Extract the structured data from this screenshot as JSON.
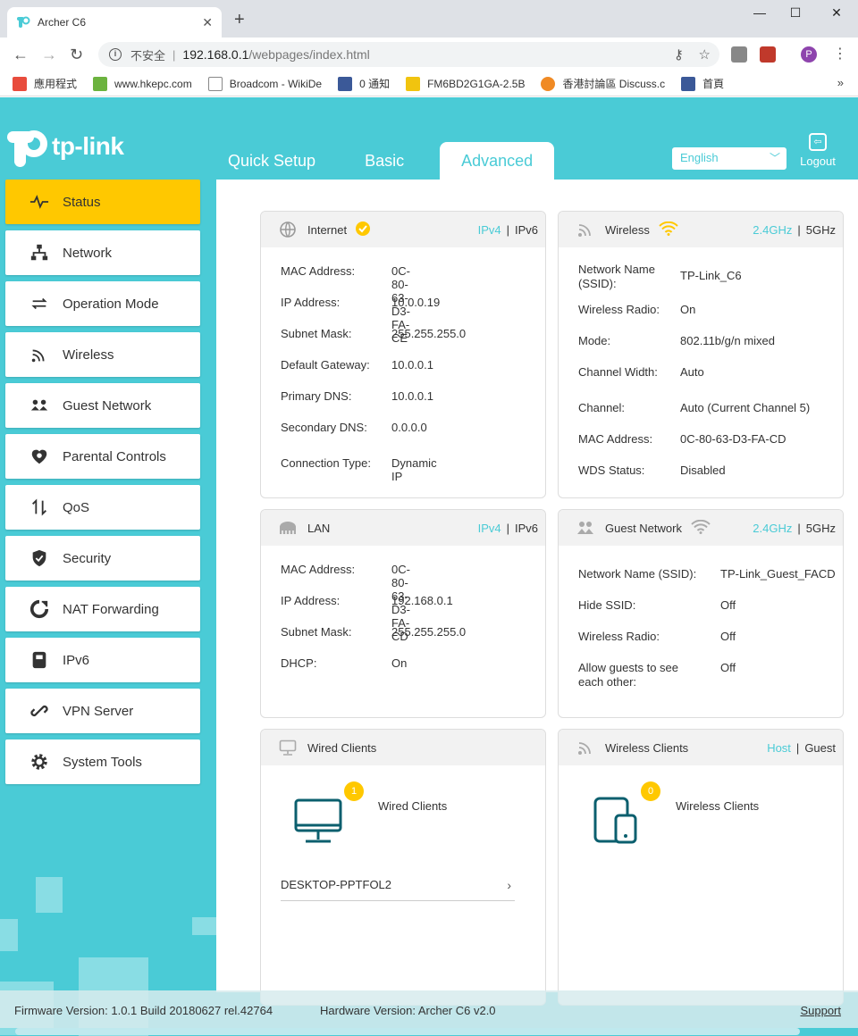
{
  "browser": {
    "tab_title": "Archer C6",
    "new_tab": "+",
    "window": {
      "minimize": "—",
      "maximize": "☐",
      "close": "✕"
    },
    "insecure": "不安全",
    "url_host": "192.168.0.1",
    "url_path": "/webpages/index.html",
    "bookmarks": [
      {
        "label": "應用程式",
        "color": "#e84c3d"
      },
      {
        "label": "www.hkepc.com",
        "color": "#6cb33f"
      },
      {
        "label": "Broadcom - WikiDe",
        "color": "#888888"
      },
      {
        "label": "0 通知",
        "color": "#3b5998"
      },
      {
        "label": "FM6BD2G1GA-2.5B",
        "color": "#333333"
      },
      {
        "label": "香港討論區 Discuss.c",
        "color": "#f08a24"
      },
      {
        "label": "首頁",
        "color": "#3b5998"
      }
    ],
    "bookmarks_more": "»",
    "profile_letter": "P"
  },
  "header": {
    "logo_text": "tp-link",
    "tabs": [
      {
        "label": "Quick Setup",
        "active": false
      },
      {
        "label": "Basic",
        "active": false
      },
      {
        "label": "Advanced",
        "active": true
      }
    ],
    "language": "English",
    "logout": "Logout"
  },
  "sidebar": {
    "items": [
      {
        "label": "Status",
        "icon": "status-icon",
        "active": true
      },
      {
        "label": "Network",
        "icon": "network-icon"
      },
      {
        "label": "Operation Mode",
        "icon": "operation-mode-icon"
      },
      {
        "label": "Wireless",
        "icon": "wireless-icon"
      },
      {
        "label": "Guest Network",
        "icon": "guest-network-icon"
      },
      {
        "label": "Parental Controls",
        "icon": "parental-controls-icon"
      },
      {
        "label": "QoS",
        "icon": "qos-icon"
      },
      {
        "label": "Security",
        "icon": "security-icon"
      },
      {
        "label": "NAT Forwarding",
        "icon": "nat-forwarding-icon"
      },
      {
        "label": "IPv6",
        "icon": "ipv6-icon"
      },
      {
        "label": "VPN Server",
        "icon": "vpn-server-icon"
      },
      {
        "label": "System Tools",
        "icon": "system-tools-icon"
      }
    ]
  },
  "internet": {
    "title": "Internet",
    "opt1": "IPv4",
    "opt2": "IPv6",
    "rows": [
      {
        "k": "MAC Address:",
        "v": "0C-80-63-D3-FA-CE"
      },
      {
        "k": "IP Address:",
        "v": "10.0.0.19"
      },
      {
        "k": "Subnet Mask:",
        "v": "255.255.255.0"
      },
      {
        "k": "Default Gateway:",
        "v": "10.0.0.1"
      },
      {
        "k": "Primary DNS:",
        "v": "10.0.0.1"
      },
      {
        "k": "Secondary DNS:",
        "v": "0.0.0.0"
      },
      {
        "k": "Connection Type:",
        "v": "Dynamic IP"
      }
    ]
  },
  "wireless": {
    "title": "Wireless",
    "opt1": "2.4GHz",
    "opt2": "5GHz",
    "rows": [
      {
        "k": "Network Name (SSID):",
        "v": "TP-Link_C6"
      },
      {
        "k": "Wireless Radio:",
        "v": "On"
      },
      {
        "k": "Mode:",
        "v": "802.11b/g/n mixed"
      },
      {
        "k": "Channel Width:",
        "v": "Auto"
      },
      {
        "k": "Channel:",
        "v": "Auto (Current Channel 5)"
      },
      {
        "k": "MAC Address:",
        "v": "0C-80-63-D3-FA-CD"
      },
      {
        "k": "WDS Status:",
        "v": "Disabled"
      }
    ]
  },
  "lan": {
    "title": "LAN",
    "opt1": "IPv4",
    "opt2": "IPv6",
    "rows": [
      {
        "k": "MAC Address:",
        "v": "0C-80-63-D3-FA-CD"
      },
      {
        "k": "IP Address:",
        "v": "192.168.0.1"
      },
      {
        "k": "Subnet Mask:",
        "v": "255.255.255.0"
      },
      {
        "k": "DHCP:",
        "v": "On"
      }
    ]
  },
  "guest": {
    "title": "Guest Network",
    "opt1": "2.4GHz",
    "opt2": "5GHz",
    "rows": [
      {
        "k": "Network Name (SSID):",
        "v": "TP-Link_Guest_FACD"
      },
      {
        "k": "Hide SSID:",
        "v": "Off"
      },
      {
        "k": "Wireless Radio:",
        "v": "Off"
      },
      {
        "k": "Allow guests to see each other:",
        "v": "Off"
      }
    ]
  },
  "wired_clients": {
    "title": "Wired Clients",
    "count": "1",
    "label": "Wired Clients",
    "clients": [
      {
        "name": "DESKTOP-PPTFOL2",
        "arrow": "›"
      }
    ]
  },
  "wireless_clients": {
    "title": "Wireless Clients",
    "opt1": "Host",
    "opt2": "Guest",
    "count": "0",
    "label": "Wireless Clients"
  },
  "footer": {
    "firmware": "Firmware Version: 1.0.1 Build 20180627 rel.42764",
    "hardware": "Hardware Version: Archer C6 v2.0",
    "support": "Support"
  },
  "colors": {
    "accent": "#4acbd6",
    "active": "#ffc800"
  }
}
